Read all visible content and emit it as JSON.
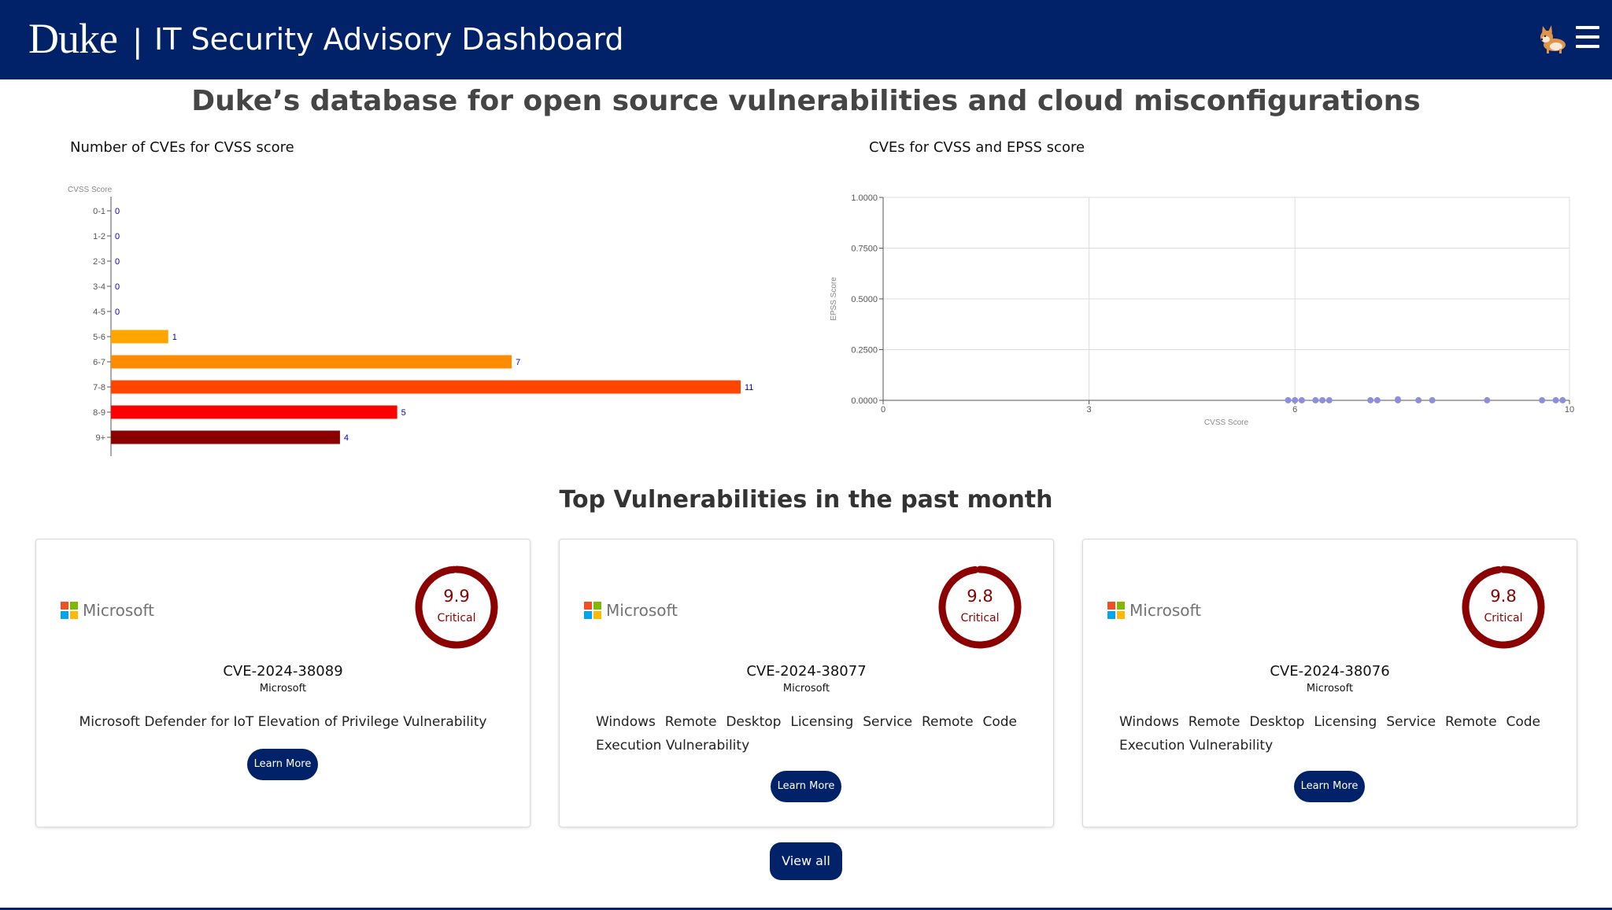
{
  "header": {
    "brand": "Duke",
    "separator": "|",
    "title": "IT Security Advisory Dashboard",
    "mascot_icon": "corgi-icon",
    "menu_icon": "hamburger-menu-icon",
    "background_color": "#012169"
  },
  "main_heading": "Duke’s database for open source vulnerabilities and cloud misconfigurations",
  "bar_chart_title": "Number of CVEs for CVSS score",
  "scatter_chart_title": "CVEs for CVSS and EPSS score",
  "chart_data": [
    {
      "type": "bar",
      "orientation": "horizontal",
      "title": "Number of CVEs for CVSS score",
      "ylabel": "CVSS Score",
      "categories": [
        "0-1",
        "1-2",
        "2-3",
        "3-4",
        "4-5",
        "5-6",
        "6-7",
        "7-8",
        "8-9",
        "9+"
      ],
      "values": [
        0,
        0,
        0,
        0,
        0,
        1,
        7,
        11,
        5,
        4
      ],
      "colors": [
        "#FFD700",
        "#FFD700",
        "#FFD700",
        "#FFD700",
        "#FFC000",
        "#FFA500",
        "#FF8C00",
        "#FF4500",
        "#FF0000",
        "#8B0000"
      ],
      "value_label_color": "#0000cd",
      "xlim": [
        0,
        11
      ]
    },
    {
      "type": "scatter",
      "title": "CVEs for CVSS and EPSS score",
      "xlabel": "CVSS Score",
      "ylabel": "EPSS Score",
      "xlim": [
        0,
        10
      ],
      "ylim": [
        0,
        1
      ],
      "x_ticks": [
        "0",
        "3",
        "6",
        "10"
      ],
      "x_tick_values": [
        0,
        3,
        6,
        10
      ],
      "y_ticks": [
        "0.0000",
        "0.2500",
        "0.5000",
        "0.7500",
        "1.0000"
      ],
      "y_tick_values": [
        0,
        0.25,
        0.5,
        0.75,
        1
      ],
      "grid": true,
      "point_color": "#8c8fdf",
      "points": [
        {
          "x": 5.9,
          "y": 0.0004
        },
        {
          "x": 6.0,
          "y": 0.0004
        },
        {
          "x": 6.1,
          "y": 0.0004
        },
        {
          "x": 6.3,
          "y": 0.0004
        },
        {
          "x": 6.4,
          "y": 0.0004
        },
        {
          "x": 6.5,
          "y": 0.0004
        },
        {
          "x": 7.1,
          "y": 0.0004
        },
        {
          "x": 7.2,
          "y": 0.0004
        },
        {
          "x": 7.5,
          "y": 0.0004
        },
        {
          "x": 7.5,
          "y": 0.005
        },
        {
          "x": 7.8,
          "y": 0.0004
        },
        {
          "x": 8.0,
          "y": 0.0004
        },
        {
          "x": 8.8,
          "y": 0.0004
        },
        {
          "x": 9.6,
          "y": 0.0004
        },
        {
          "x": 9.8,
          "y": 0.0004
        },
        {
          "x": 9.9,
          "y": 0.0004
        }
      ]
    }
  ],
  "top_section_heading": "Top Vulnerabilities in the past month",
  "cards": [
    {
      "vendor_logo_text": "Microsoft",
      "logo_icon": "microsoft-logo-icon",
      "score": "9.9",
      "score_fraction": 0.99,
      "severity": "Critical",
      "cve_id": "CVE-2024-38089",
      "vendor": "Microsoft",
      "description": "Microsoft Defender for IoT Elevation of Privilege Vulnerability",
      "button": "Learn More"
    },
    {
      "vendor_logo_text": "Microsoft",
      "logo_icon": "microsoft-logo-icon",
      "score": "9.8",
      "score_fraction": 0.98,
      "severity": "Critical",
      "cve_id": "CVE-2024-38077",
      "vendor": "Microsoft",
      "description": "Windows Remote Desktop Licensing Service Remote Code Execution Vulnerability",
      "button": "Learn More"
    },
    {
      "vendor_logo_text": "Microsoft",
      "logo_icon": "microsoft-logo-icon",
      "score": "9.8",
      "score_fraction": 0.98,
      "severity": "Critical",
      "cve_id": "CVE-2024-38076",
      "vendor": "Microsoft",
      "description": "Windows Remote Desktop Licensing Service Remote Code Execution Vulnerability",
      "button": "Learn More"
    }
  ],
  "view_all_button": "View all",
  "colors": {
    "navy": "#012169",
    "critical": "#8b0000",
    "ring_track": "#e0e0e0"
  }
}
